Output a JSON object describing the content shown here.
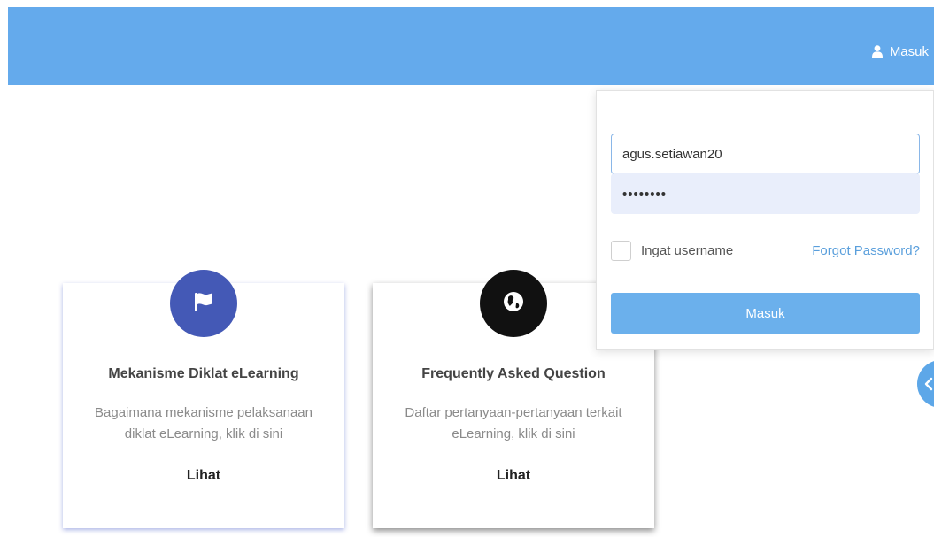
{
  "header": {
    "login_label": "Masuk",
    "accent_color": "#64aaec",
    "login_icon": "user-icon"
  },
  "cards": [
    {
      "icon": "flag-icon",
      "icon_color": "#4459b6",
      "title": "Mekanisme Diklat eLearning",
      "description": "Bagaimana mekanisme pelaksanaan diklat eLearning, klik di sini",
      "link_label": "Lihat"
    },
    {
      "icon": "globe-icon",
      "icon_color": "#111111",
      "title": "Frequently Asked Question",
      "description": "Daftar pertanyaan-pertanyaan terkait eLearning, klik di sini",
      "link_label": "Lihat"
    }
  ],
  "login_form": {
    "username_value": "agus.setiawan20",
    "password_value": "••••••••",
    "remember_label": "Ingat username",
    "remember_checked": false,
    "forgot_label": "Forgot Password?",
    "submit_label": "Masuk"
  },
  "side_toggle": {
    "icon": "chevron-left-icon"
  }
}
